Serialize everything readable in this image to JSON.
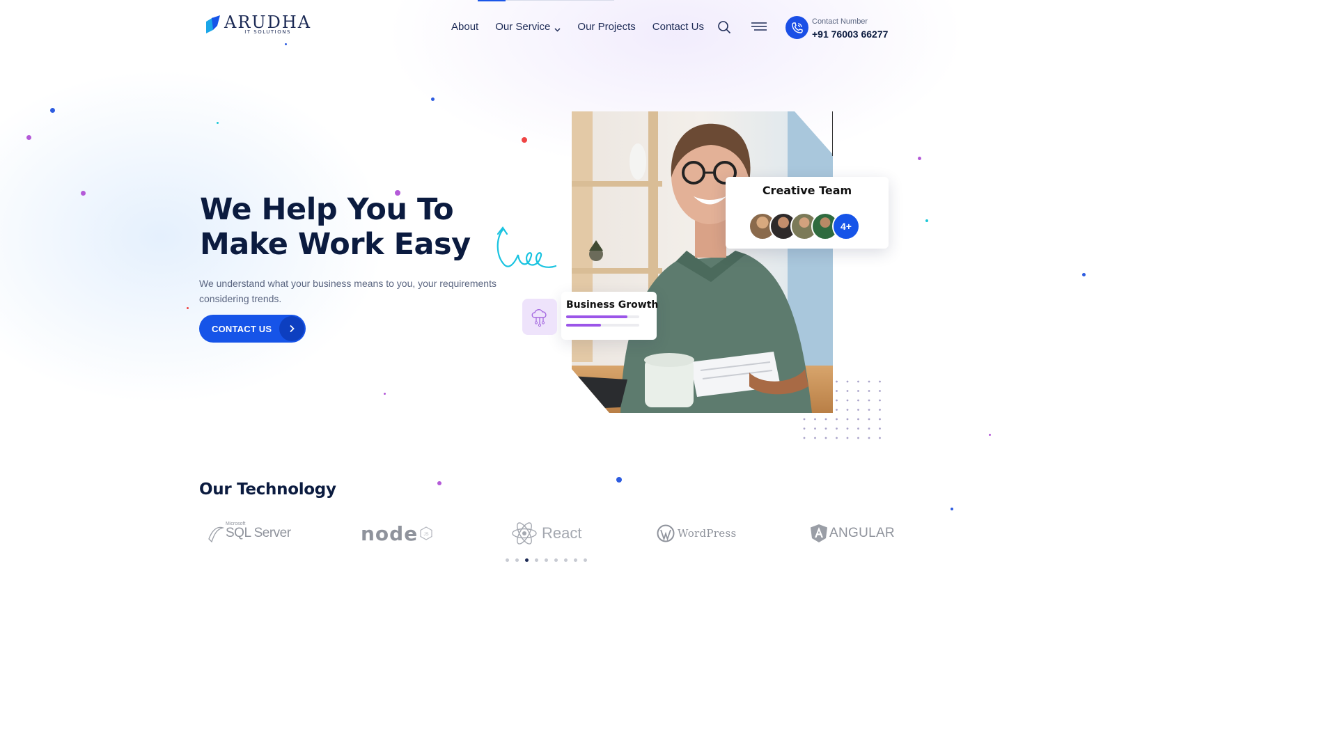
{
  "brand": {
    "name": "ARUDHA",
    "tagline": "IT SOLUTIONS"
  },
  "nav": {
    "items": [
      {
        "label": "About"
      },
      {
        "label": "Our Service"
      },
      {
        "label": "Our Projects"
      },
      {
        "label": "Contact Us"
      }
    ]
  },
  "header_contact": {
    "label": "Contact Number",
    "number": "+91 76003 66277"
  },
  "hero": {
    "title": "We Help You To Make Work Easy",
    "description": "We understand what your business means to you, your requirements considering trends.",
    "cta_label": "CONTACT US"
  },
  "team_card": {
    "title": "Creative Team",
    "more_label": "4+"
  },
  "growth_card": {
    "title": "Business Growth",
    "progress": [
      0.84,
      0.48
    ]
  },
  "technology": {
    "title": "Our Technology",
    "logos": [
      {
        "name": "SQL Server",
        "small": "Microsoft"
      },
      {
        "name": "node"
      },
      {
        "name": "React"
      },
      {
        "name": "WordPress"
      },
      {
        "name": "ANGULAR"
      }
    ],
    "pager": {
      "count": 9,
      "active": 2
    }
  },
  "colors": {
    "primary": "#1654e8",
    "navy": "#0b1b3f",
    "purple": "#9b55e8",
    "cyan": "#19c3e0"
  }
}
